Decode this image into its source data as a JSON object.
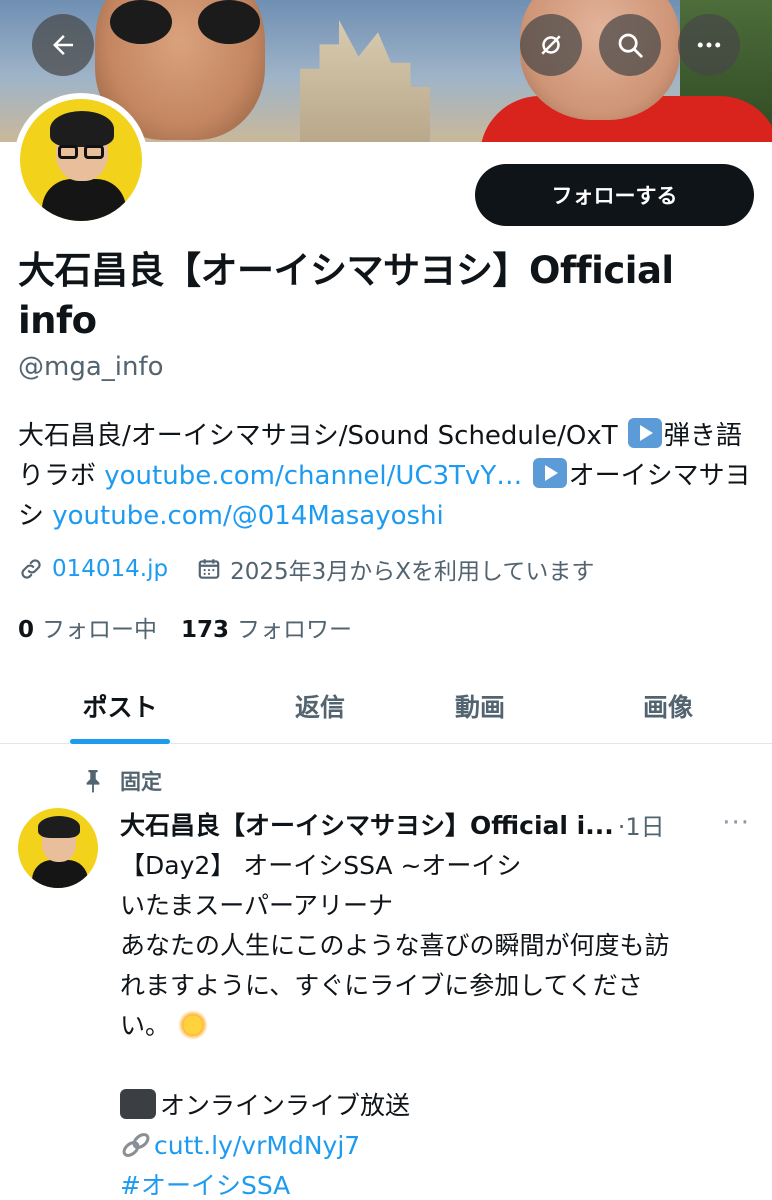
{
  "header": {
    "back_icon": "arrow-left-icon",
    "circle_icon": "no-signal-icon",
    "search_icon": "search-icon",
    "more_icon": "more-horizontal-icon"
  },
  "profile": {
    "follow_label": "フォローする",
    "name": "大石昌良【オーイシマサヨシ】Official info",
    "handle": "@mga_info",
    "bio": {
      "part1": "大石昌良/オーイシマサヨシ/Sound Schedule/OxT ",
      "part2": "弾き語りラボ ",
      "link1": "youtube.com/channel/UC3TvY…",
      "part3": " ",
      "part4": "オーイシマサヨシ ",
      "link2": "youtube.com/@014Masayoshi"
    },
    "website": "014014.jp",
    "joined": "2025年3月からXを利用しています",
    "following_count": "0",
    "following_label": "フォロー中",
    "followers_count": "173",
    "followers_label": "フォロワー"
  },
  "tabs": [
    {
      "label": "ポスト",
      "active": true
    },
    {
      "label": "返信",
      "active": false
    },
    {
      "label": "動画",
      "active": false
    },
    {
      "label": "画像",
      "active": false
    }
  ],
  "post": {
    "pinned_label": "固定",
    "author": "大石昌良【オーイシマサヨシ】Official i...",
    "time": "·1日",
    "more": "···",
    "lines": [
      "【Day2】 オーイシSSA ~オーイシ",
      "いたまスーパーアリーナ",
      "あなたの人生にこのような喜びの瞬間が何度も訪",
      "れますように、すぐにライブに参加してくださ",
      "い。"
    ],
    "live_label": "オンラインライブ放送",
    "url": "cutt.ly/vrMdNyj7",
    "hashtag": "#オーイシSSA"
  }
}
